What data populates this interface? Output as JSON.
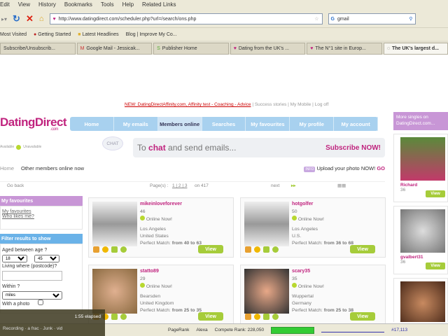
{
  "browser": {
    "menu": [
      "Edit",
      "View",
      "History",
      "Bookmarks",
      "Tools",
      "Help",
      "Related Links"
    ],
    "url": "http://www.datingdirect.com/scheduler.php?url=/search/ons.php",
    "search_value": "gmail",
    "bookmarks": [
      "Most Visited",
      "Getting Started",
      "Latest Headlines",
      "Blog | Improve My Co..."
    ],
    "tabs": [
      "Subscribe/Unsubscrib...",
      "Google Mail - Jessicak...",
      "Publisher Home",
      "Dating from the UK's ...",
      "The N°1 site in Europ...",
      "The UK's largest d..."
    ]
  },
  "page": {
    "toplinks": {
      "promo": "NEW: DatingDirectAffinity.com, Affinity test - Coaching - Advice",
      "links": [
        "Success stories",
        "My Mobile",
        "Log off"
      ]
    },
    "logo": "DatingDirect",
    "logo_sub": ".com",
    "nav": [
      "Home",
      "My emails",
      "Members online",
      "Searches",
      "My favourites",
      "My profile",
      "My account"
    ],
    "availability": {
      "on": "Available",
      "off": "Unavailable"
    },
    "chat_bubble": "CHAT",
    "chat_text_pre": "To ",
    "chat_text_em": "chat",
    "chat_text_post": " and send emails...",
    "subscribe": "Subscribe NOW!",
    "breadcrumb": {
      "home": "Home",
      "current": "Other members online now"
    },
    "upload": {
      "badge": "INFO",
      "text": "Upload your photo NOW!",
      "go": "GO"
    },
    "paging": {
      "back": "Go back",
      "pages_label": "Page(s) :",
      "pages": "1 | 2 | 3",
      "of": "on 417",
      "next": "next"
    },
    "left": {
      "fav_title": "My favourites",
      "fav_links": [
        "My favourites",
        "Who likes me?"
      ],
      "filter_title": "Filter results to show",
      "age_label": "Aged between age ?",
      "age_from": "18",
      "age_to": "45",
      "where_label": "Living where (postcode)?",
      "within_label": "Within ?",
      "within_value": "miles",
      "photo_label": "With a photo"
    },
    "members": [
      {
        "name": "mikeinloveforever",
        "age": "46",
        "status": "Online Now!",
        "city": "Los Angeles",
        "country": "United States",
        "match_label": "Perfect Match:",
        "match": "from 40 to 63",
        "view": "View"
      },
      {
        "name": "hotgolfer",
        "age": "50",
        "status": "Online Now!",
        "city": "Los Angeles",
        "country": "U.S.",
        "match_label": "Perfect Match:",
        "match": "from 36 to 68",
        "view": "View"
      },
      {
        "name": "statto89",
        "age": "29",
        "status": "Online Now!",
        "city": "Bearsden",
        "country": "United Kingdom",
        "match_label": "Perfect Match:",
        "match": "from 25 to 35",
        "view": "View"
      },
      {
        "name": "scary35",
        "age": "35",
        "status": "Online Now!",
        "city": "Wuppertal",
        "country": "Germany",
        "match_label": "Perfect Match:",
        "match": "from 25 to 38",
        "view": "View"
      }
    ],
    "right": {
      "title": "More singles on DatingDirect.com...",
      "singles": [
        {
          "name": "Richard",
          "age": "36",
          "view": "View"
        },
        {
          "name": "gvalbert31",
          "age": "36",
          "view": "View"
        }
      ]
    }
  },
  "statusbar": {
    "pagerank": "PageRank",
    "alexa": "Alexa",
    "compete": "Compete Rank: 228,050",
    "rank": "#17,113"
  },
  "video": {
    "elapsed": "1:55 elapsed",
    "tray": "Recording · a frac · Junk · vid"
  }
}
